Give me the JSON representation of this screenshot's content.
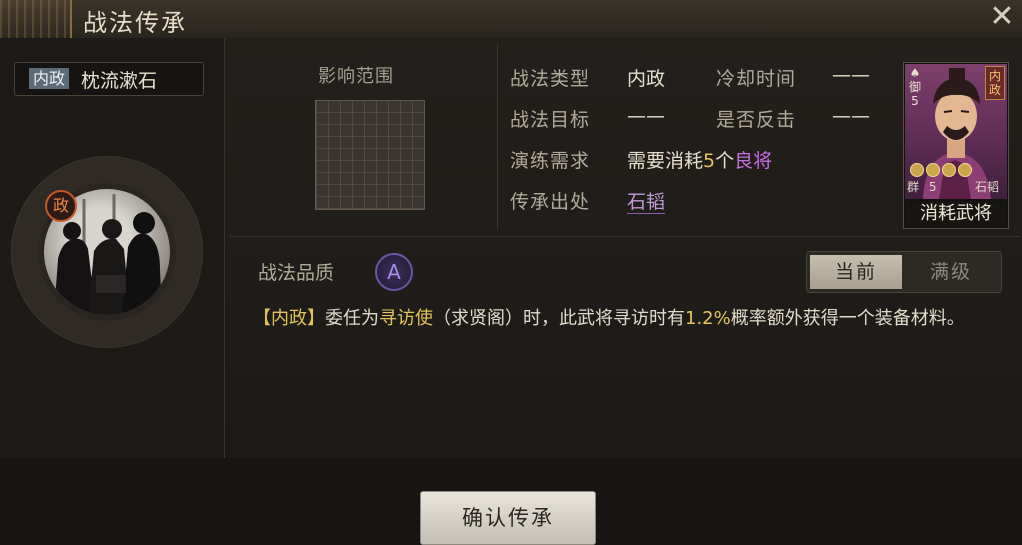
{
  "window": {
    "title": "战法传承",
    "close_icon": "close-icon"
  },
  "skill": {
    "category_badge": "内政",
    "name": "枕流漱石",
    "portrait_badge": "政"
  },
  "range": {
    "label": "影响范围"
  },
  "info": {
    "type_label": "战法类型",
    "type_value": "内政",
    "cooldown_label": "冷却时间",
    "cooldown_value": "——",
    "target_label": "战法目标",
    "target_value": "——",
    "counter_label": "是否反击",
    "counter_value": "——",
    "require_label": "演练需求",
    "require_prefix": "需要消耗",
    "require_count": "5",
    "require_unit": "个",
    "require_rank": "良将",
    "source_label": "传承出处",
    "source_value": "石韬"
  },
  "card": {
    "tag": "内政",
    "left_label": "御",
    "left_value": "5",
    "stars": 4,
    "faction": "群",
    "cost": "5",
    "name": "石韬",
    "caption": "消耗武将"
  },
  "quality": {
    "label": "战法品质",
    "grade": "A"
  },
  "tabs": {
    "current": "当前",
    "max": "满级"
  },
  "description": {
    "tag": "【内政】",
    "p1": "委任为",
    "role": "寻访使",
    "p2": "（求贤阁）时，此武将寻访时有",
    "rate": "1.2%",
    "p3": "概率额外获得一个装备材料。"
  },
  "footer": {
    "confirm_label": "确认传承"
  },
  "colors": {
    "gold": "#e6c35a",
    "purple": "#c56fe0",
    "background": "#1c1a18"
  }
}
